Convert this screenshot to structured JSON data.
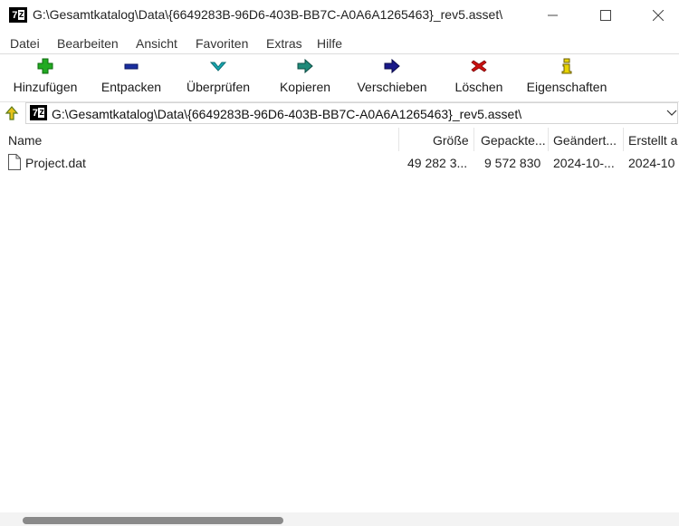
{
  "window": {
    "title": "G:\\Gesamtkatalog\\Data\\{6649283B-96D6-403B-BB7C-A0A6A1265463}_rev5.asset\\",
    "logo_main": "7",
    "logo_sub": "z"
  },
  "menu": [
    "Datei",
    "Bearbeiten",
    "Ansicht",
    "Favoriten",
    "Extras",
    "Hilfe"
  ],
  "toolbar": [
    {
      "label": "Hinzufügen",
      "icon": "plus-icon",
      "color": "#22aa22"
    },
    {
      "label": "Entpacken",
      "icon": "minus-icon",
      "color": "#1a2fa0"
    },
    {
      "label": "Überprüfen",
      "icon": "check-down-icon",
      "color": "#17a7b0"
    },
    {
      "label": "Kopieren",
      "icon": "copy-arrow-icon",
      "color": "#1f8a7a"
    },
    {
      "label": "Verschieben",
      "icon": "move-arrow-icon",
      "color": "#1a1a8a"
    },
    {
      "label": "Löschen",
      "icon": "delete-x-icon",
      "color": "#cc1111"
    },
    {
      "label": "Eigenschaften",
      "icon": "info-icon",
      "color": "#d8c400"
    }
  ],
  "address": {
    "path": "G:\\Gesamtkatalog\\Data\\{6649283B-96D6-403B-BB7C-A0A6A1265463}_rev5.asset\\"
  },
  "columns": [
    "Name",
    "Größe",
    "Gepackte...",
    "Geändert...",
    "Erstellt a"
  ],
  "rows": [
    {
      "name": "Project.dat",
      "size": "49 282 3...",
      "packed": "9 572 830",
      "modified": "2024-10-...",
      "created": "2024-10"
    }
  ]
}
